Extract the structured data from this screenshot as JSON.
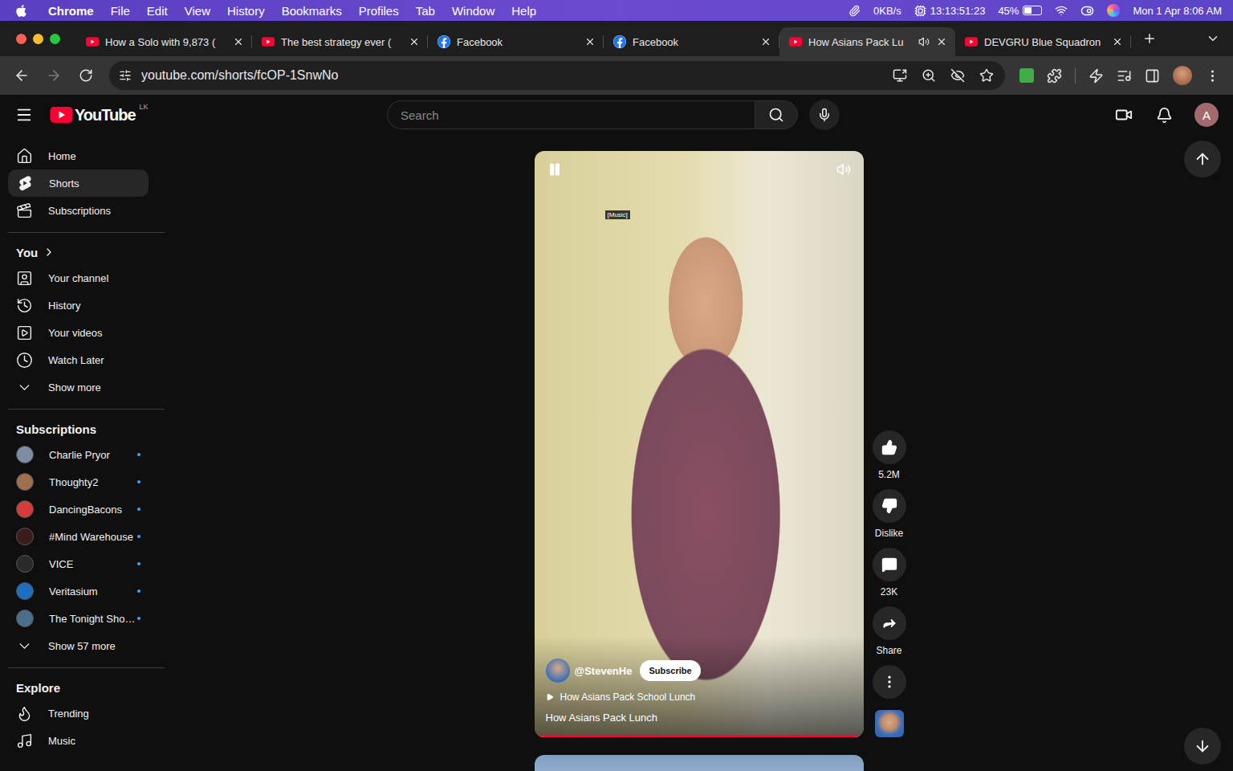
{
  "menubar": {
    "app": "Chrome",
    "menus": [
      "File",
      "Edit",
      "View",
      "History",
      "Bookmarks",
      "Profiles",
      "Tab",
      "Window",
      "Help"
    ],
    "network": "0KB/s",
    "timer": "13:13:51:23",
    "battery": "45%",
    "battery_level": 0.45,
    "clock": "Mon 1 Apr 8:06 AM"
  },
  "tabs": [
    {
      "label": "How a Solo with 9,873 (",
      "site": "youtube",
      "selected": false,
      "audio": false
    },
    {
      "label": "The best strategy ever (",
      "site": "youtube",
      "selected": false,
      "audio": false
    },
    {
      "label": "Facebook",
      "site": "facebook",
      "selected": false,
      "audio": false
    },
    {
      "label": "Facebook",
      "site": "facebook",
      "selected": false,
      "audio": false
    },
    {
      "label": "How Asians Pack Lu",
      "site": "youtube",
      "selected": true,
      "audio": true
    },
    {
      "label": "DEVGRU Blue Squadron",
      "site": "youtube",
      "selected": false,
      "audio": false
    }
  ],
  "toolbar": {
    "url": "youtube.com/shorts/fcOP-1SnwNo",
    "back_enabled": true,
    "forward_enabled": false
  },
  "youtube": {
    "logo": "YouTube",
    "region": "LK",
    "search_placeholder": "Search",
    "avatar": "A"
  },
  "sidebar": {
    "main": [
      {
        "label": "Home",
        "kind": "home",
        "selected": false
      },
      {
        "label": "Shorts",
        "kind": "shorts",
        "selected": true
      },
      {
        "label": "Subscriptions",
        "kind": "subscriptions",
        "selected": false
      }
    ],
    "you_heading": "You",
    "you": [
      {
        "label": "Your channel",
        "kind": "channel",
        "selected": false
      },
      {
        "label": "History",
        "kind": "history",
        "selected": false
      },
      {
        "label": "Your videos",
        "kind": "videos",
        "selected": false
      },
      {
        "label": "Watch Later",
        "kind": "later",
        "selected": false
      },
      {
        "label": "Show more",
        "kind": "expand",
        "selected": false
      }
    ],
    "subscriptions_heading": "Subscriptions",
    "subscriptions": [
      {
        "name": "Charlie Pryor",
        "new": true,
        "color": "#7d8ea3"
      },
      {
        "name": "Thoughty2",
        "new": true,
        "color": "#a0704e"
      },
      {
        "name": "DancingBacons",
        "new": true,
        "color": "#d63b3b"
      },
      {
        "name": "#Mind Warehouse",
        "new": true,
        "color": "#3a1c1c"
      },
      {
        "name": "VICE",
        "new": true,
        "color": "#2a2a2a"
      },
      {
        "name": "Veritasium",
        "new": true,
        "color": "#1f6fc0"
      },
      {
        "name": "The Tonight Sho…",
        "new": true,
        "color": "#4a6f8a"
      }
    ],
    "subscriptions_more": "Show 57 more",
    "explore_heading": "Explore",
    "explore": [
      {
        "label": "Trending",
        "kind": "trending",
        "selected": false
      },
      {
        "label": "Music",
        "kind": "music",
        "selected": false
      }
    ]
  },
  "short": {
    "playing": true,
    "caption": "[Music]",
    "channel": "@StevenHe",
    "subscribe": "Subscribe",
    "subscribed": false,
    "linked_video": "How Asians Pack School Lunch",
    "title": "How Asians Pack Lunch",
    "progress": 0.99
  },
  "actions": [
    {
      "kind": "like",
      "label": "5.2M"
    },
    {
      "kind": "dislike",
      "label": "Dislike"
    },
    {
      "kind": "comments",
      "label": "23K"
    },
    {
      "kind": "share",
      "label": "Share"
    }
  ]
}
